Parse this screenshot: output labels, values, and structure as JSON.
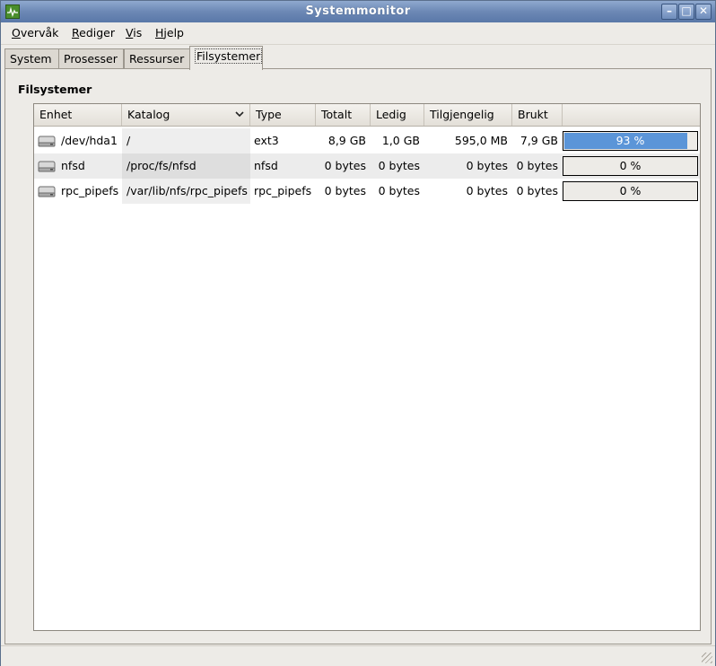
{
  "window": {
    "title": "Systemmonitor"
  },
  "menu": [
    {
      "pre": "",
      "u": "O",
      "post": "vervåk"
    },
    {
      "pre": "",
      "u": "R",
      "post": "ediger"
    },
    {
      "pre": "",
      "u": "V",
      "post": "is"
    },
    {
      "pre": "",
      "u": "H",
      "post": "jelp"
    }
  ],
  "tabs": [
    "System",
    "Prosesser",
    "Ressurser",
    "Filsystemer"
  ],
  "active_tab": "Filsystemer",
  "section_title": "Filsystemer",
  "columns": [
    "Enhet",
    "Katalog",
    "Type",
    "Totalt",
    "Ledig",
    "Tilgjengelig",
    "Brukt",
    ""
  ],
  "rows": [
    {
      "enhet": "/dev/hda1",
      "katalog": "/",
      "type": "ext3",
      "totalt": "8,9 GB",
      "ledig": "1,0 GB",
      "tilgjengelig": "595,0 MB",
      "brukt": "7,9 GB",
      "pct_label": "93 %",
      "pct": 0.93
    },
    {
      "enhet": "nfsd",
      "katalog": "/proc/fs/nfsd",
      "type": "nfsd",
      "totalt": "0 bytes",
      "ledig": "0 bytes",
      "tilgjengelig": "0 bytes",
      "brukt": "0 bytes",
      "pct_label": "0 %",
      "pct": 0
    },
    {
      "enhet": "rpc_pipefs",
      "katalog": "/var/lib/nfs/rpc_pipefs",
      "type": "rpc_pipefs",
      "totalt": "0 bytes",
      "ledig": "0 bytes",
      "tilgjengelig": "0 bytes",
      "brukt": "0 bytes",
      "pct_label": "0 %",
      "pct": 0
    }
  ],
  "colors": {
    "titlebar": "#6c88b5",
    "progress_fill": "#5b95d8"
  },
  "icons": {
    "app": "system-monitor-icon",
    "disk": "harddisk-icon",
    "sort": "chevron-down-icon"
  }
}
